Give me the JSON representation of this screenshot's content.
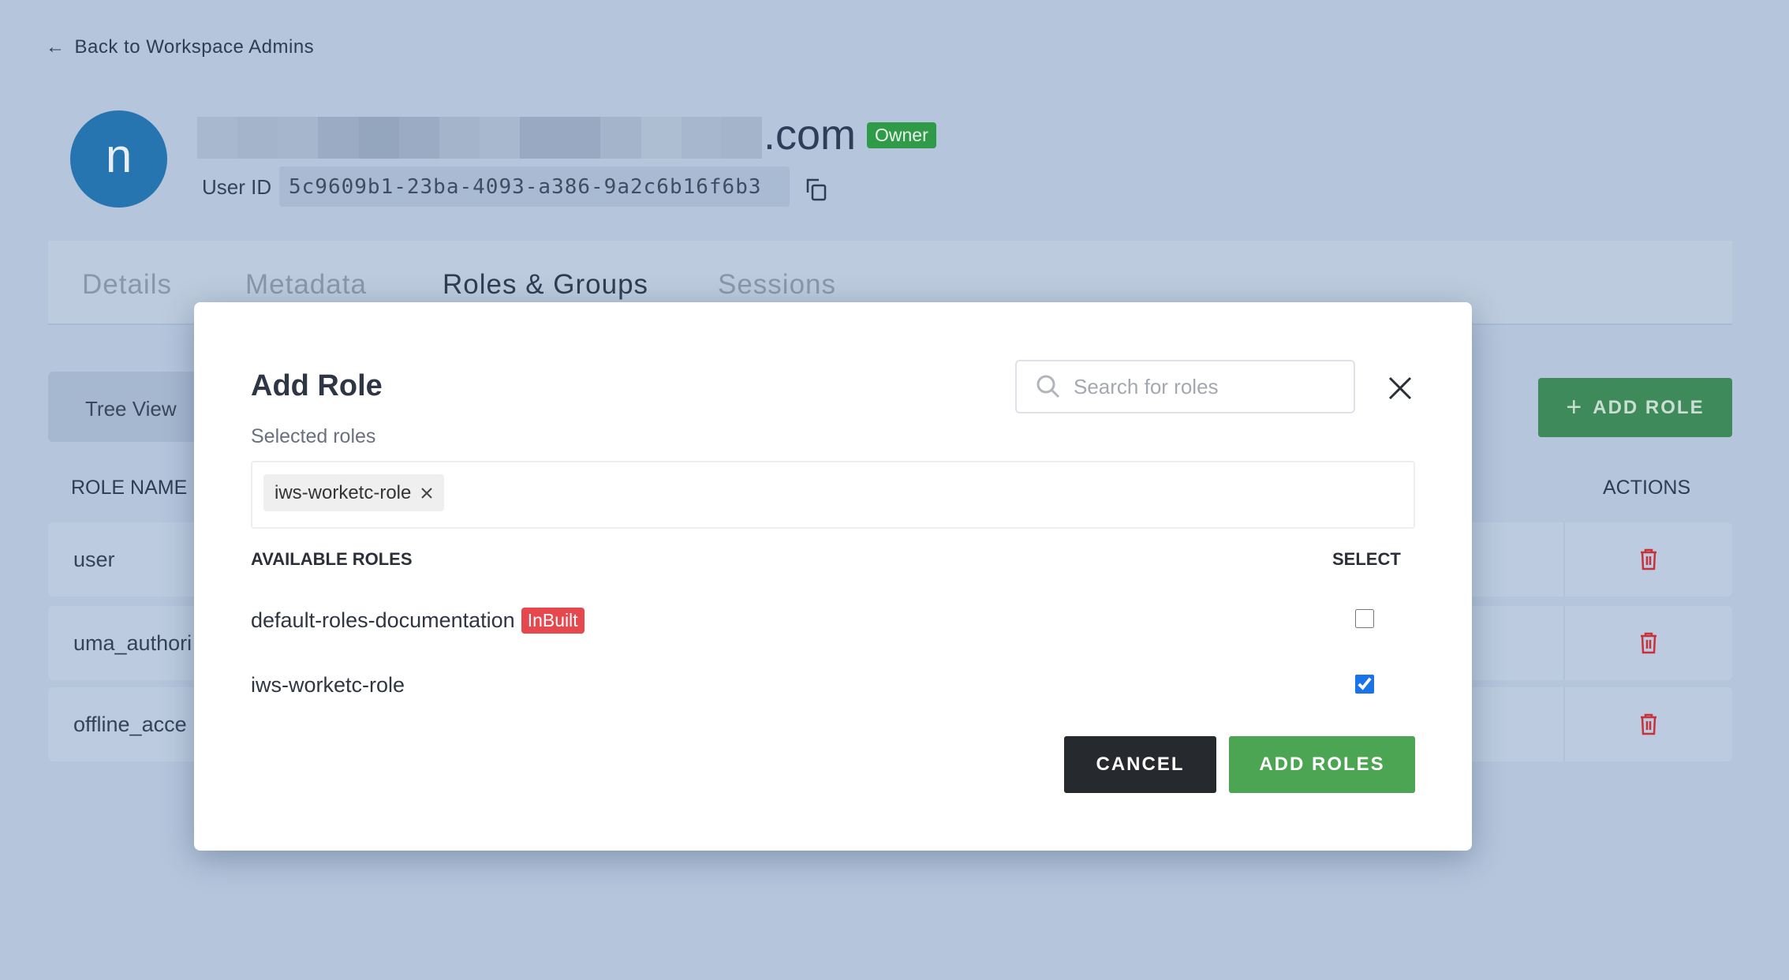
{
  "back_link": "Back to Workspace Admins",
  "user": {
    "avatar_letter": "n",
    "email_suffix": ".com",
    "role_badge": "Owner",
    "user_id_label": "User ID",
    "user_id": "5c9609b1-23ba-4093-a386-9a2c6b16f6b3"
  },
  "tabs": [
    {
      "label": "Details"
    },
    {
      "label": "Metadata"
    },
    {
      "label": "Roles & Groups",
      "active": true
    },
    {
      "label": "Sessions"
    }
  ],
  "toolbar": {
    "tree_view": "Tree View",
    "add_role": "ADD ROLE"
  },
  "table": {
    "headers": [
      "ROLE NAME",
      "ACTIONS"
    ],
    "rows": [
      {
        "name": "user"
      },
      {
        "name": "uma_authori"
      },
      {
        "name": "offline_acce"
      }
    ]
  },
  "modal": {
    "title": "Add Role",
    "search_placeholder": "Search for roles",
    "selected_label": "Selected roles",
    "selected_chips": [
      "iws-worketc-role"
    ],
    "available_header": "AVAILABLE ROLES",
    "select_header": "SELECT",
    "roles": [
      {
        "name": "default-roles-documentation",
        "badge": "InBuilt",
        "checked": false
      },
      {
        "name": "iws-worketc-role",
        "checked": true
      }
    ],
    "cancel": "CANCEL",
    "add_roles": "ADD ROLES"
  },
  "colors": {
    "owner_badge": "#2f9a48",
    "inbuilt_badge": "#e5484d",
    "primary_green": "#4ca553",
    "avatar": "#2674b0",
    "checkbox": "#1a73e8",
    "trash": "#c8303a"
  }
}
